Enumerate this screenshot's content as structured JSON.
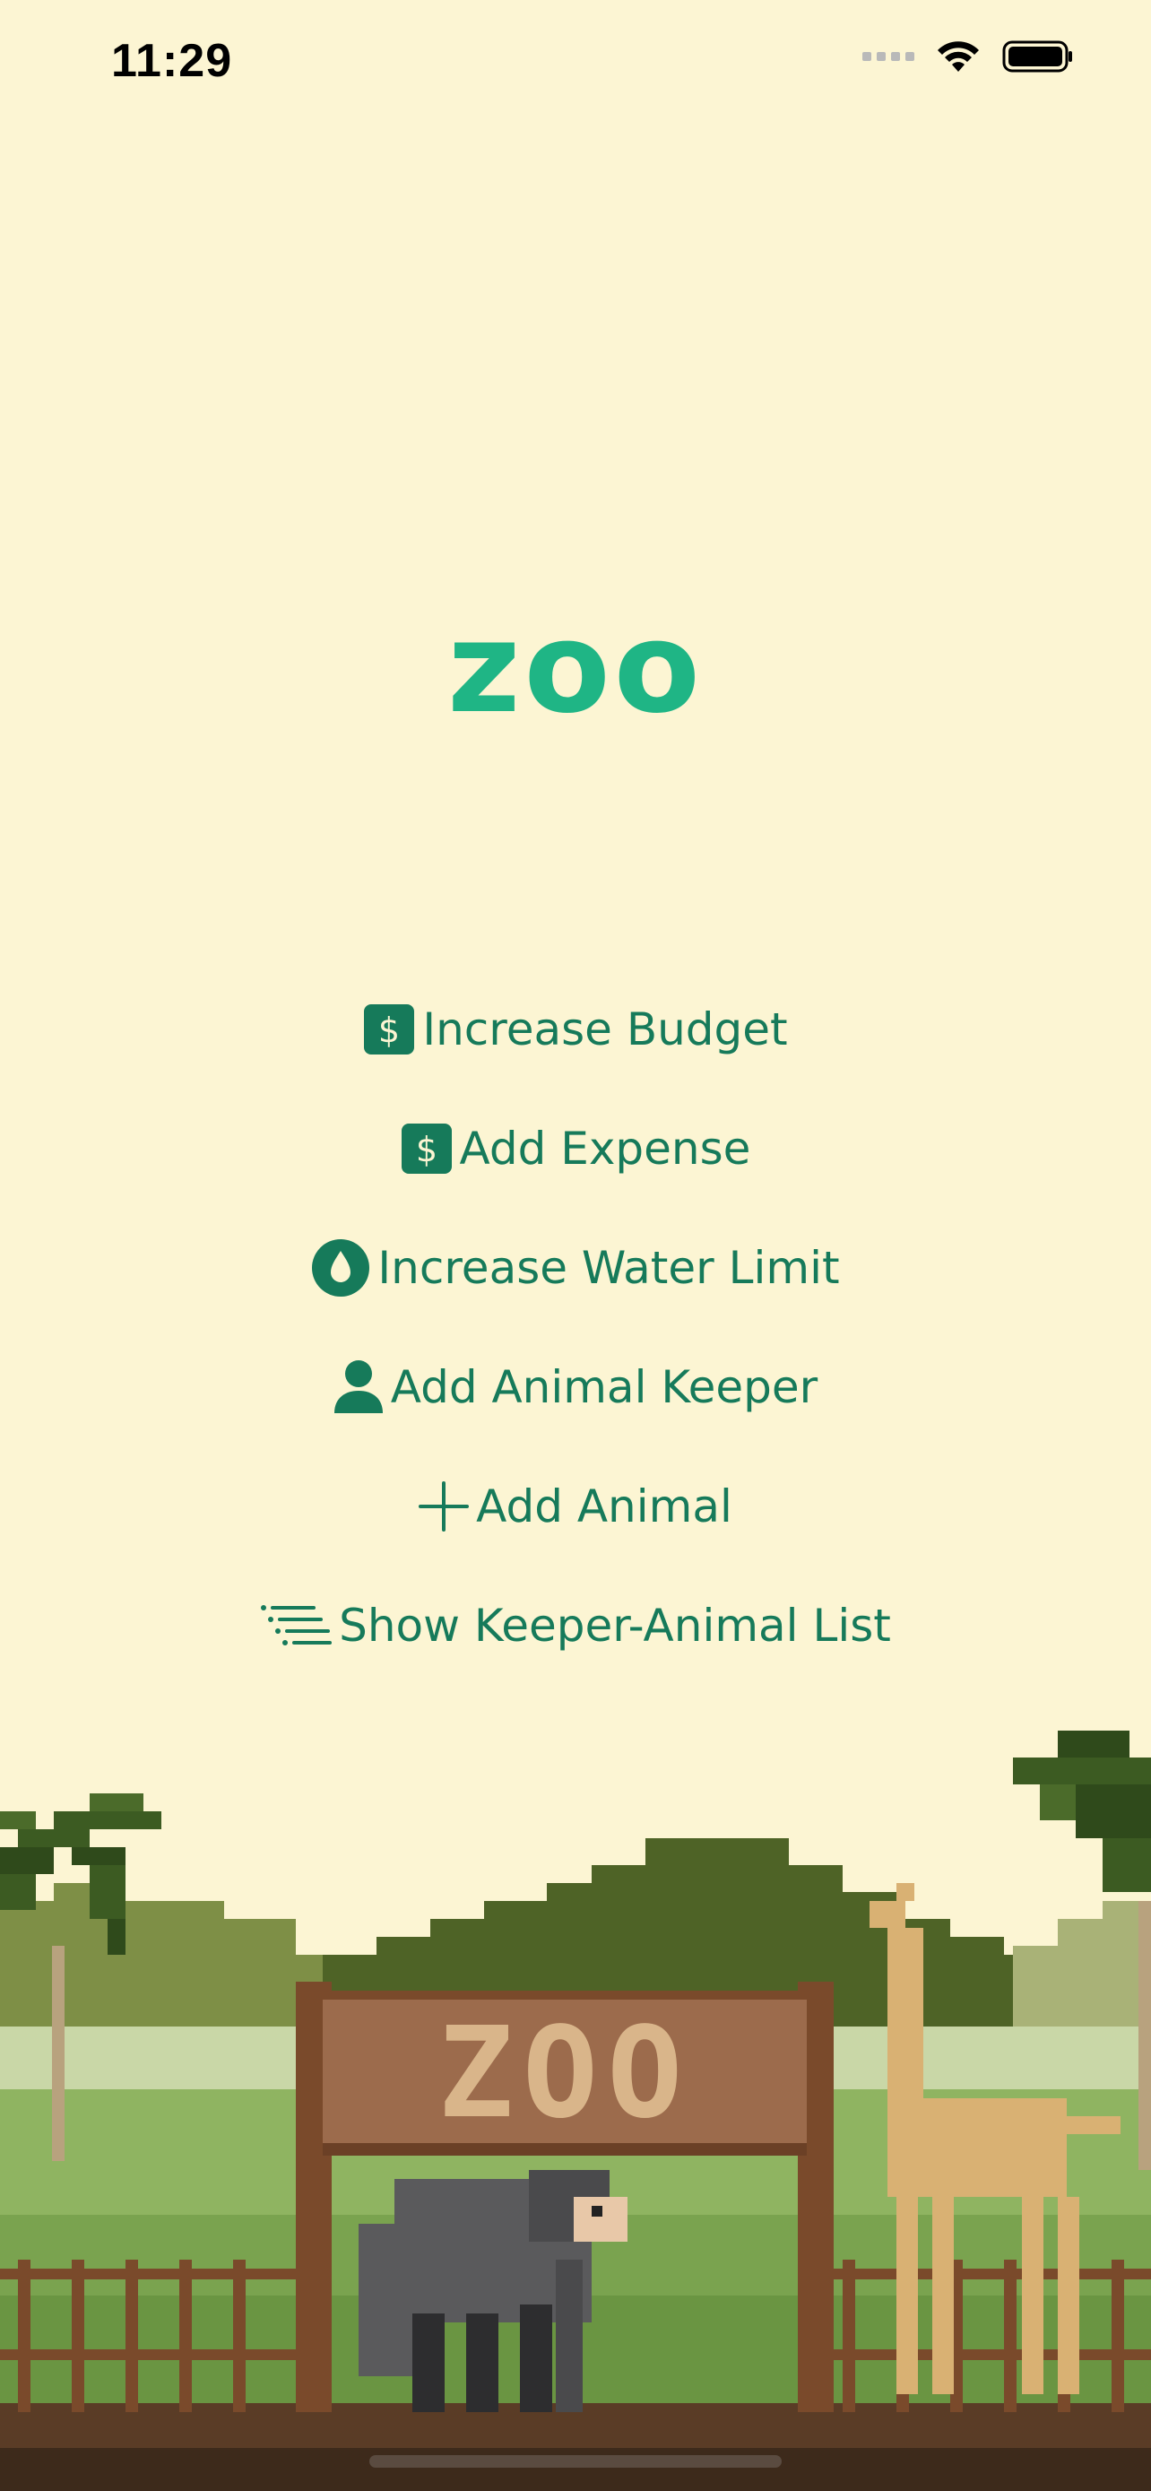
{
  "status_bar": {
    "time": "11:29",
    "icons": [
      "cellular-signal-icon",
      "wifi-icon",
      "battery-icon"
    ]
  },
  "app": {
    "logo_text": "zoo"
  },
  "menu": {
    "items": [
      {
        "label": "Increase Budget",
        "icon": "dollar-sign-icon"
      },
      {
        "label": "Add Expense",
        "icon": "dollar-sign-icon"
      },
      {
        "label": "Increase Water Limit",
        "icon": "water-drop-icon"
      },
      {
        "label": "Add Animal Keeper",
        "icon": "person-icon"
      },
      {
        "label": "Add Animal",
        "icon": "plus-icon"
      },
      {
        "label": "Show Keeper-Animal List",
        "icon": "list-icon"
      }
    ]
  },
  "scene": {
    "sign_text": "ZOO",
    "characters": [
      "gorilla",
      "giraffe",
      "palm-tree"
    ]
  },
  "colors": {
    "background": "#fcf5d3",
    "accent": "#1fb585",
    "menu_text": "#167a5a"
  }
}
